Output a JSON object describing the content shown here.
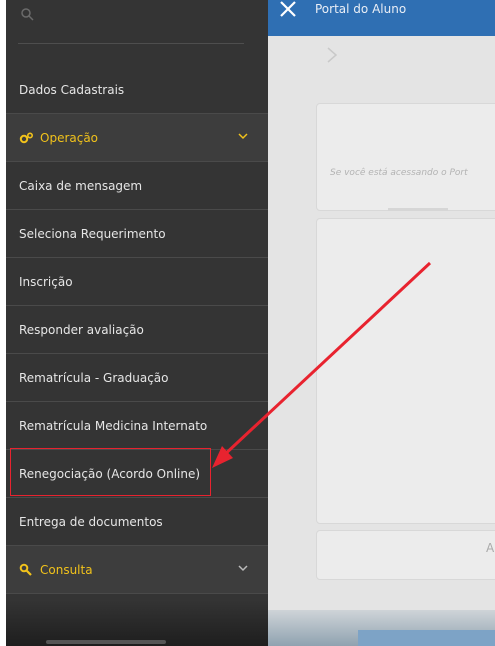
{
  "sidebar": {
    "items": [
      {
        "label": "Dados Cadastrais",
        "group": false
      },
      {
        "label": "Operação",
        "group": true,
        "icon": "gears-icon"
      },
      {
        "label": "Caixa de mensagem",
        "group": false
      },
      {
        "label": "Seleciona Requerimento",
        "group": false
      },
      {
        "label": "Inscrição",
        "group": false
      },
      {
        "label": "Responder avaliação",
        "group": false
      },
      {
        "label": "Rematrícula - Graduação",
        "group": false
      },
      {
        "label": "Rematrícula Medicina Internato",
        "group": false
      },
      {
        "label": "Renegociação (Acordo Online)",
        "group": false,
        "highlighted": true
      },
      {
        "label": "Entrega de documentos",
        "group": false
      },
      {
        "label": "Consulta",
        "group": true,
        "icon": "search-icon"
      }
    ]
  },
  "header": {
    "title": "Portal do Aluno"
  },
  "main": {
    "notice": "Se você está acessando o Port",
    "partial_letter": "A"
  },
  "colors": {
    "accent_yellow": "#f1c21b",
    "sidebar_bg": "#343434",
    "header_blue": "#2f6fb3",
    "annotation_red": "#e8232f"
  }
}
